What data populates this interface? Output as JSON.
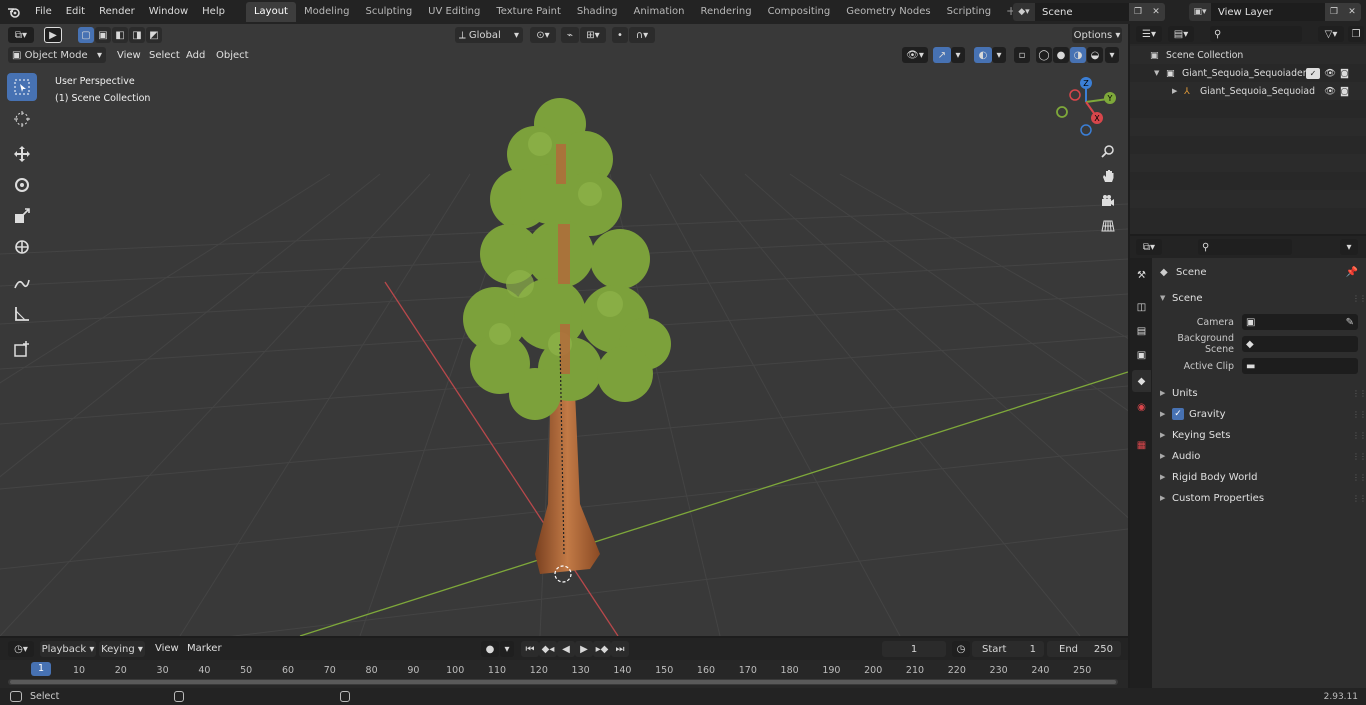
{
  "menu": [
    "File",
    "Edit",
    "Render",
    "Window",
    "Help"
  ],
  "workspaces": [
    "Layout",
    "Modeling",
    "Sculpting",
    "UV Editing",
    "Texture Paint",
    "Shading",
    "Animation",
    "Rendering",
    "Compositing",
    "Geometry Nodes",
    "Scripting"
  ],
  "active_workspace": "Layout",
  "scene_name": "Scene",
  "view_layer": "View Layer",
  "viewport": {
    "mode": "Object Mode",
    "menus": [
      "View",
      "Select",
      "Add",
      "Object"
    ],
    "transform_orientation": "Global",
    "options_label": "Options",
    "overlay_perspective": "User Perspective",
    "overlay_collection": "(1) Scene Collection",
    "axis_labels": {
      "x": "X",
      "y": "Y",
      "z": "Z"
    }
  },
  "outliner": {
    "root": "Scene Collection",
    "items": [
      "Giant_Sequoia_Sequoiadendr",
      "Giant_Sequoia_Sequoiad"
    ]
  },
  "properties": {
    "context_title": "Scene",
    "panel_title": "Scene",
    "fields": [
      {
        "label": "Camera",
        "value": ""
      },
      {
        "label": "Background Scene",
        "value": ""
      },
      {
        "label": "Active Clip",
        "value": ""
      }
    ],
    "panels": [
      "Units",
      "Gravity",
      "Keying Sets",
      "Audio",
      "Rigid Body World",
      "Custom Properties"
    ],
    "gravity_checked": true
  },
  "timeline": {
    "menus": [
      "Playback",
      "Keying",
      "View",
      "Marker"
    ],
    "current_frame": "1",
    "start_label": "Start",
    "start": "1",
    "end_label": "End",
    "end": "250",
    "ruler": [
      "1",
      "10",
      "20",
      "30",
      "40",
      "50",
      "60",
      "70",
      "80",
      "90",
      "100",
      "110",
      "120",
      "130",
      "140",
      "150",
      "160",
      "170",
      "180",
      "190",
      "200",
      "210",
      "220",
      "230",
      "240",
      "250"
    ]
  },
  "status": {
    "select_label": "Select",
    "version": "2.93.11"
  },
  "colors": {
    "accent": "#4772b3",
    "x_axis": "#c8474b",
    "y_axis": "#7ea83a",
    "foliage": "#7ca13b",
    "trunk": "#b5683a"
  }
}
